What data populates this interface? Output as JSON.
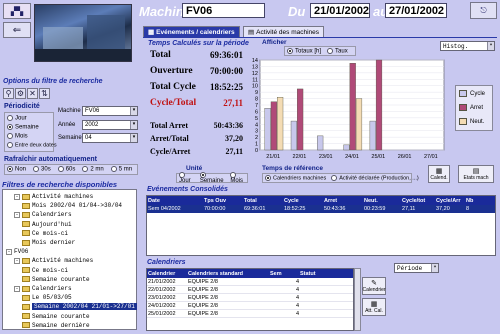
{
  "header": {
    "machine_label": "Machine",
    "machine_value": "FV06",
    "du_label": "Du",
    "date_from": "21/01/2002",
    "au_label": "au",
    "date_to": "27/01/2002"
  },
  "left": {
    "options_title": "Options du filtre de recherche",
    "periodicite_label": "Périodicité",
    "periodicite_options": [
      "Jour",
      "Semaine",
      "Mois",
      "Entre deux dates"
    ],
    "periodicite_selected": "Semaine",
    "machine_label": "Machine",
    "machine_value": "FV06",
    "annee_label": "Année",
    "annee_value": "2002",
    "semaine_label": "Semaine",
    "semaine_value": "04",
    "refresh_title": "Rafraîchir automatiquement",
    "refresh_options": [
      "Non",
      "30s",
      "60s",
      "2 mn",
      "5 mn"
    ],
    "refresh_selected": "Non",
    "saved_title": "Filtres de recherche disponibles",
    "tree": [
      {
        "label": "Activité machines",
        "level": 0,
        "sign": "-",
        "folder": true
      },
      {
        "label": "Mois 2002/04 01/04->30/04",
        "level": 1,
        "sign": "",
        "folder": true
      },
      {
        "label": "Calendriers",
        "level": 0,
        "sign": "-",
        "folder": true
      },
      {
        "label": "Aujourd'hui",
        "level": 1,
        "sign": "",
        "folder": true
      },
      {
        "label": "Ce mois-ci",
        "level": 1,
        "sign": "",
        "folder": true
      },
      {
        "label": "Mois dernier",
        "level": 1,
        "sign": "",
        "folder": true
      },
      {
        "label": "FV06",
        "level": -1,
        "sign": "-",
        "folder": false
      },
      {
        "label": "Activité machines",
        "level": 0,
        "sign": "-",
        "folder": true
      },
      {
        "label": "Ce mois-ci",
        "level": 1,
        "sign": "",
        "folder": true
      },
      {
        "label": "Semaine courante",
        "level": 1,
        "sign": "",
        "folder": true
      },
      {
        "label": "Calendriers",
        "level": 0,
        "sign": "-",
        "folder": true
      },
      {
        "label": "Le 05/03/05",
        "level": 1,
        "sign": "",
        "folder": true
      },
      {
        "label": "Semaine 2002/04 21/01->27/01",
        "level": 1,
        "sign": "",
        "folder": true,
        "selected": true
      },
      {
        "label": "Semaine courante",
        "level": 1,
        "sign": "",
        "folder": true
      },
      {
        "label": "Semaine dernière",
        "level": 1,
        "sign": "",
        "folder": true
      }
    ]
  },
  "tabs": {
    "tab1": "Evénements / calendriers",
    "tab2": "Activité des machines"
  },
  "stats": {
    "title": "Temps Calculés sur la période",
    "rows": [
      {
        "label": "Total",
        "value": "69:36:01",
        "red": false
      },
      {
        "label": "Ouverture",
        "value": "70:00:00",
        "red": false
      },
      {
        "label": "Total Cycle",
        "value": "18:52:25",
        "red": false
      },
      {
        "label": "Cycle/Total",
        "value": "27,11",
        "red": true
      }
    ],
    "rows2": [
      {
        "label": "Total Arret",
        "value": "50:43:36"
      },
      {
        "label": "Arret/Total",
        "value": "37,20"
      },
      {
        "label": "Cycle/Arret",
        "value": "27,11"
      }
    ]
  },
  "afficher": {
    "label": "Afficher",
    "opt1": "Totaux [h]",
    "opt2": "Taux",
    "chart_type": "Histog."
  },
  "chart_data": {
    "type": "bar",
    "categories": [
      "21/01",
      "22/01",
      "23/01",
      "24/01",
      "25/01",
      "26/01",
      "27/01"
    ],
    "series": [
      {
        "name": "Cycle",
        "color": "#c8c8ec",
        "values": [
          6.5,
          4.5,
          2.2,
          0.8,
          4.5,
          0,
          0
        ]
      },
      {
        "name": "Arret",
        "color": "#b04a78",
        "values": [
          7.5,
          9.5,
          0,
          13.5,
          14.0,
          0,
          0
        ]
      },
      {
        "name": "Neut.",
        "color": "#f4dcb4",
        "values": [
          8.2,
          0,
          0,
          8.0,
          0,
          0,
          0
        ]
      }
    ],
    "ylim": [
      0,
      14
    ],
    "yticks": [
      "0",
      "1",
      "2",
      "3",
      "4",
      "5",
      "6",
      "7",
      "8",
      "9",
      "10",
      "11",
      "12",
      "13",
      "14"
    ]
  },
  "unite": {
    "label": "Unité",
    "options": [
      "Jour",
      "Semaine",
      "Mois"
    ],
    "selected": "Semaine"
  },
  "temps_ref": {
    "label": "Temps de référence",
    "options": [
      "Calendriers machines",
      "Activité déclarée (Production, ...)"
    ],
    "selected": "Calendriers machines"
  },
  "buttons": {
    "calend": "Calend.",
    "etats": "Etats mach",
    "calendrier": "Calendrier",
    "attcal": "Att. Cal."
  },
  "events": {
    "title": "Evénements Consolidés",
    "headers": [
      "Date",
      "Tps Ouv",
      "Total",
      "Cycle",
      "Arret",
      "Neut.",
      "Cycle/tot",
      "Cycle/Arr",
      "Nb"
    ],
    "rows": [
      [
        "Sem 04/2002",
        "70:00:00",
        "69:36:01",
        "18:52:25",
        "50:43:36",
        "00:23:59",
        "27,11",
        "37,20",
        "8"
      ]
    ]
  },
  "calendriers": {
    "title": "Calendriers",
    "period_value": "Période",
    "headers": [
      "Calendrier",
      "Calendriers standard",
      "Sem",
      "Statut"
    ],
    "rows": [
      [
        "21/01/2002",
        "EQUIPE 2/8",
        "4",
        ""
      ],
      [
        "22/01/2002",
        "EQUIPE 2/8",
        "4",
        ""
      ],
      [
        "23/01/2002",
        "EQUIPE 2/8",
        "4",
        ""
      ],
      [
        "24/01/2002",
        "EQUIPE 2/8",
        "4",
        ""
      ],
      [
        "25/01/2002",
        "EQUIPE 2/8",
        "4",
        ""
      ]
    ]
  }
}
